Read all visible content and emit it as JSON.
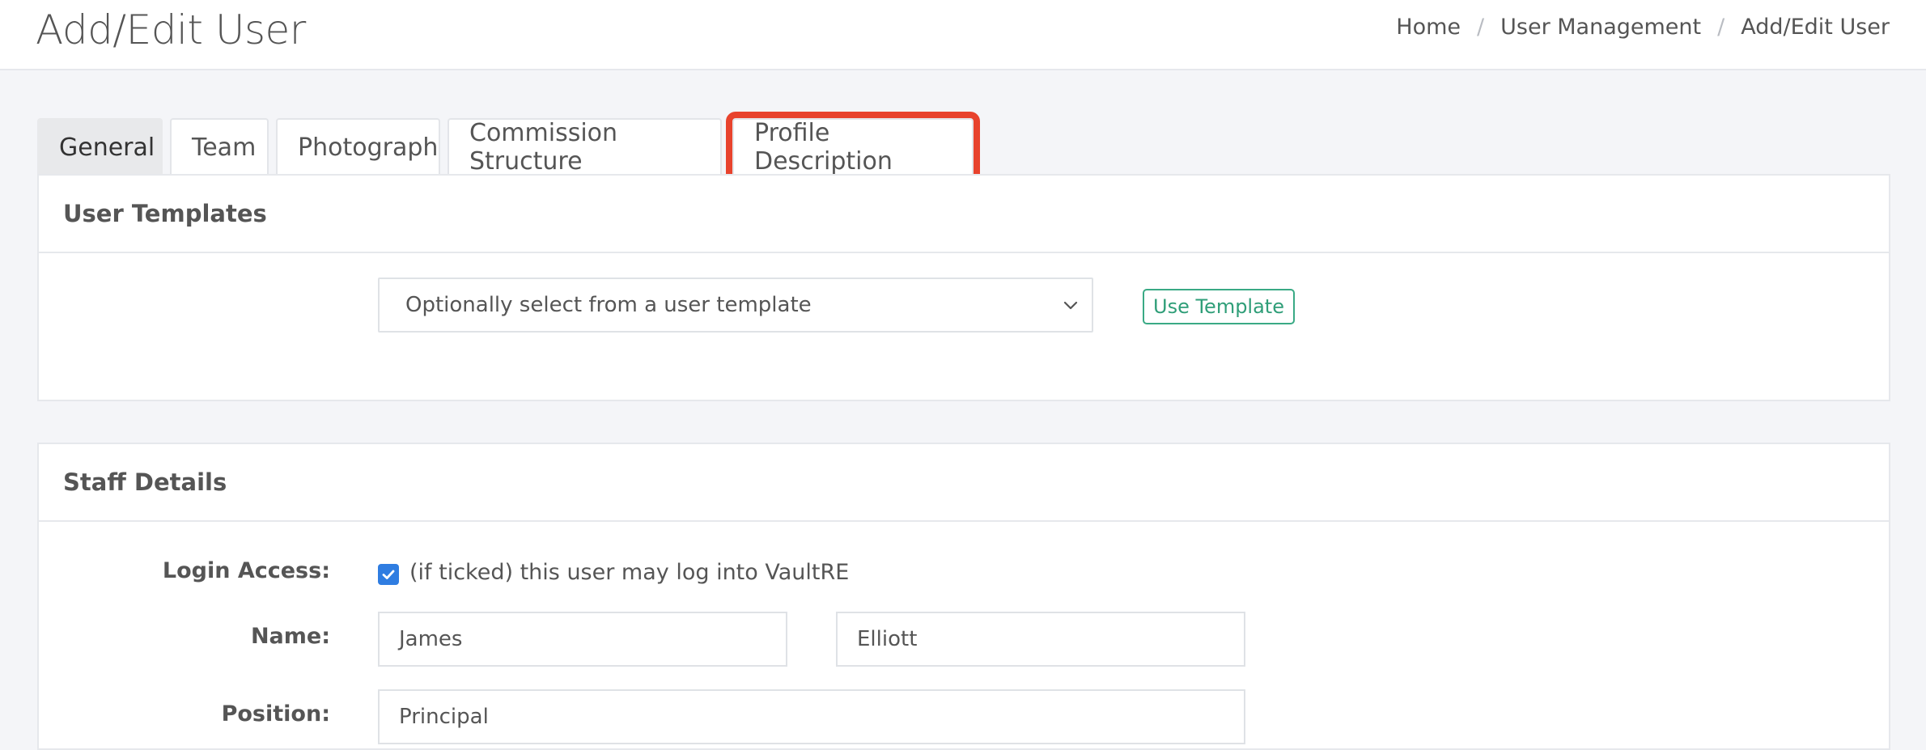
{
  "header": {
    "title": "Add/Edit User",
    "breadcrumb": [
      "Home",
      "User Management",
      "Add/Edit User"
    ],
    "breadcrumb_separator": "/"
  },
  "tabs": [
    {
      "label": "General",
      "active": true
    },
    {
      "label": "Team"
    },
    {
      "label": "Photograph"
    },
    {
      "label": "Commission Structure"
    },
    {
      "label": "Profile Description",
      "highlighted": true
    }
  ],
  "user_templates": {
    "heading": "User Templates",
    "select_value": "Optionally select from a user template",
    "button_label": "Use Template"
  },
  "staff_details": {
    "heading": "Staff Details",
    "login_access_label": "Login Access:",
    "login_access_checked": true,
    "login_access_text": "(if ticked) this user may log into VaultRE",
    "name_label": "Name:",
    "first_name": "James",
    "last_name": "Elliott",
    "position_label": "Position:",
    "position": "Principal"
  },
  "colors": {
    "highlight": "#e8432d",
    "accent_green": "#3aaa85",
    "checkbox_blue": "#2f7de1"
  }
}
